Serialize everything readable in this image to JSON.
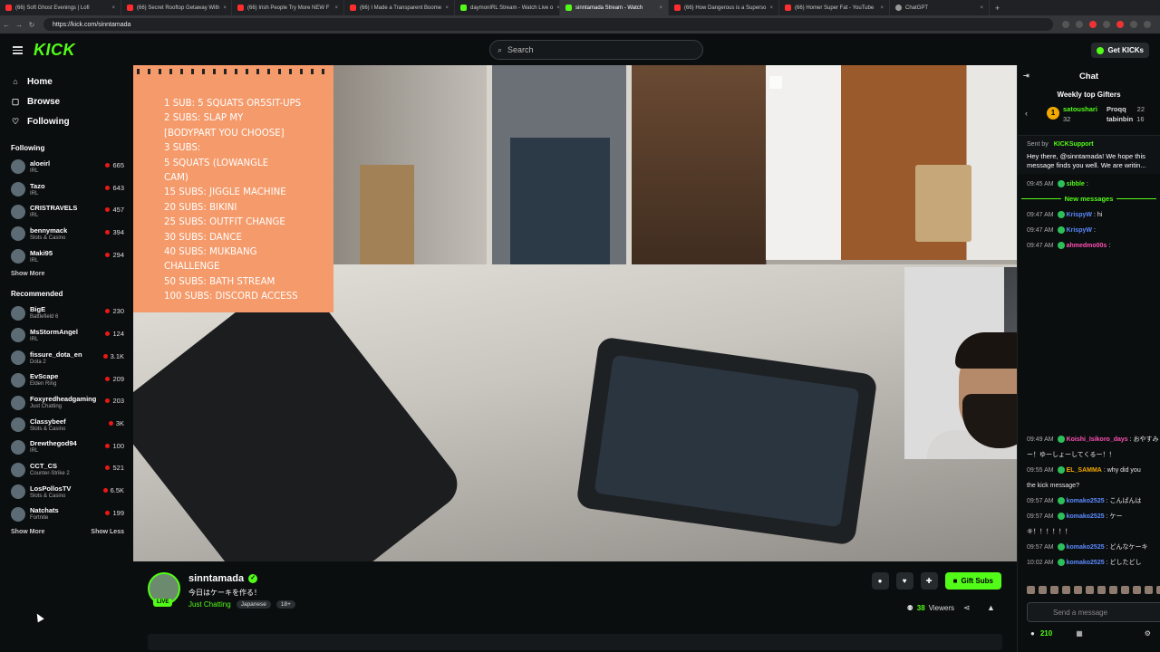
{
  "browser": {
    "tabs": [
      {
        "label": "(66) Soft Ghost Evenings | Lofi",
        "kind": "yt"
      },
      {
        "label": "(66) Secret Rooftop Getaway With",
        "kind": "yt"
      },
      {
        "label": "(66) Irish People Try More NEW F",
        "kind": "yt"
      },
      {
        "label": "(66) I Made a Transparent Boome",
        "kind": "yt"
      },
      {
        "label": "daymonIRL Stream - Watch Live o",
        "kind": "kick"
      },
      {
        "label": "sinntamada Stream - Watch",
        "kind": "kick",
        "active": true
      },
      {
        "label": "(66) How Dangerous is a Superso",
        "kind": "yt"
      },
      {
        "label": "(66) Homer Super Fat - YouTube",
        "kind": "yt"
      },
      {
        "label": "ChatGPT",
        "kind": "gpt"
      }
    ],
    "url": "https://kick.com/sinntamada"
  },
  "header": {
    "logo": "KICK",
    "search_placeholder": "Search",
    "get_kicks": "Get KICKs"
  },
  "sidebar": {
    "nav": [
      {
        "label": "Home",
        "icon": "home-icon"
      },
      {
        "label": "Browse",
        "icon": "browse-icon"
      },
      {
        "label": "Following",
        "icon": "heart-icon"
      }
    ],
    "following_title": "Following",
    "following": [
      {
        "name": "aloeirl",
        "category": "IRL",
        "viewers": "665"
      },
      {
        "name": "Tazo",
        "category": "IRL",
        "viewers": "643"
      },
      {
        "name": "CRISTRAVELS",
        "category": "IRL",
        "viewers": "457"
      },
      {
        "name": "bennymack",
        "category": "Slots & Casino",
        "viewers": "394"
      },
      {
        "name": "Maki95",
        "category": "IRL",
        "viewers": "294"
      }
    ],
    "show_more_1": "Show More",
    "recommended_title": "Recommended",
    "recommended": [
      {
        "name": "BigE",
        "category": "Battlefield 6",
        "viewers": "230"
      },
      {
        "name": "MsStormAngel",
        "category": "IRL",
        "viewers": "124"
      },
      {
        "name": "fissure_dota_en",
        "category": "Dota 2",
        "viewers": "3.1K"
      },
      {
        "name": "EvScape",
        "category": "Elden Ring",
        "viewers": "209"
      },
      {
        "name": "Foxyredheadgaming",
        "category": "Just Chatting",
        "viewers": "203"
      },
      {
        "name": "Classybeef",
        "category": "Slots & Casino",
        "viewers": "3K"
      },
      {
        "name": "Drewthegod94",
        "category": "IRL",
        "viewers": "100"
      },
      {
        "name": "CCT_CS",
        "category": "Counter-Strike 2",
        "viewers": "521"
      },
      {
        "name": "LosPollosTV",
        "category": "Slots & Casino",
        "viewers": "6.5K"
      },
      {
        "name": "Natchats",
        "category": "Fortnite",
        "viewers": "199"
      }
    ],
    "show_more_2": "Show More",
    "show_less": "Show Less"
  },
  "video": {
    "sign_lines": [
      "1 SUB: 5 SQUATS or5SIT-UPS",
      "2 SUBS: SLAP MY",
      "[BODYPART YOU CHOOSE]",
      "3 SUBS:",
      "5    SQUATS    (LOWANGLE",
      "CAM)",
      "15 SUBS: JIGGLE MACHINE",
      "20 SUBS: BIKINI",
      "25 SUBS: OUTFIT CHANGE",
      "30 SUBS: DANCE",
      "40 SUBS: MUKBANG",
      "CHALLENGE",
      "50 SUBS: BATH STREAM",
      "100 SUBS: DISCORD ACCESS"
    ]
  },
  "stream": {
    "live_badge": "LIVE",
    "streamer": "sinntamada",
    "title": "今日はケーキを作る！",
    "category": "Just Chatting",
    "tags": [
      "Japanese",
      "18+"
    ],
    "gift_subs": "Gift Subs",
    "viewers_count": "38",
    "viewers_label": "Viewers"
  },
  "chat": {
    "title": "Chat",
    "gifters_title": "Weekly top Gifters",
    "gifters": [
      {
        "rank": "1",
        "name": "satoushari",
        "count": "32"
      },
      {
        "rank": "",
        "name": "Proqq",
        "count": "22"
      },
      {
        "rank": "",
        "name": "tabinbin",
        "count": "16"
      }
    ],
    "system": {
      "sent_by_label": "Sent by",
      "sender": "KICKSupport",
      "text": "Hey there, @sinntamada! We hope this message finds you well. We are writin..."
    },
    "messages_top": [
      {
        "time": "09:45 AM",
        "user": "sibble",
        "text": "",
        "color": "#53fc18"
      }
    ],
    "new_messages": "New messages",
    "messages_mid": [
      {
        "time": "09:47 AM",
        "user": "KrispyW",
        "text": "hi",
        "color": "#5d8bff"
      },
      {
        "time": "09:47 AM",
        "user": "KrispyW",
        "text": "",
        "color": "#5d8bff"
      },
      {
        "time": "09:47 AM",
        "user": "ahmedmo00s",
        "text": "",
        "color": "#ff4fb5"
      }
    ],
    "messages_bottom": [
      {
        "time": "09:49 AM",
        "user": "Koishi_Isikoro_days",
        "text": "おやすみ",
        "color": "#ff4fb5"
      },
      {
        "time": "",
        "user": "",
        "text": "ー！ゆーしょーしてくるー！！",
        "color": "#fff"
      },
      {
        "time": "09:55 AM",
        "user": "EL_SAMMA",
        "text": "why did you",
        "color": "#f2a900"
      },
      {
        "time": "",
        "user": "",
        "text": "the kick message?",
        "color": "#fff"
      },
      {
        "time": "09:57 AM",
        "user": "komako2525",
        "text": "こんばんは",
        "color": "#5d8bff"
      },
      {
        "time": "09:57 AM",
        "user": "komako2525",
        "text": "ケー",
        "color": "#5d8bff"
      },
      {
        "time": "",
        "user": "",
        "text": "キ！！！！！！",
        "color": "#fff"
      },
      {
        "time": "09:57 AM",
        "user": "komako2525",
        "text": "どんなケーキ",
        "color": "#5d8bff"
      },
      {
        "time": "10:02 AM",
        "user": "komako2525",
        "text": "どしたどし",
        "color": "#5d8bff"
      }
    ],
    "send_placeholder": "Send a message",
    "kicks_balance": "210"
  }
}
